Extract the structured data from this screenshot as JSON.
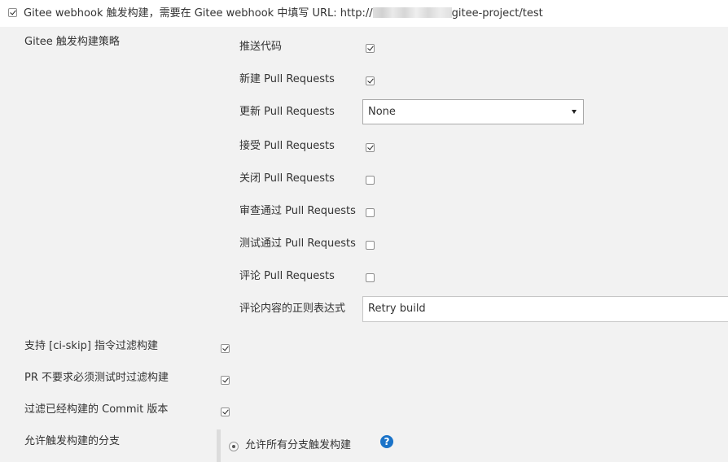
{
  "trigger": {
    "label_prefix": "Gitee webhook 触发构建，需要在 Gitee webhook 中填写 URL: http://",
    "label_suffix": "gitee-project/test",
    "checked": true
  },
  "strategy": {
    "title": "Gitee 触发构建策略",
    "push_code": {
      "label": "推送代码",
      "checked": true
    },
    "new_pr": {
      "label": "新建 Pull Requests",
      "checked": true
    },
    "update_pr": {
      "label": "更新 Pull Requests",
      "value": "None"
    },
    "accept_pr": {
      "label": "接受 Pull Requests",
      "checked": true
    },
    "close_pr": {
      "label": "关闭 Pull Requests",
      "checked": false
    },
    "review_pr": {
      "label": "审查通过 Pull Requests",
      "checked": false
    },
    "test_pr": {
      "label": "测试通过 Pull Requests",
      "checked": false
    },
    "comment_pr": {
      "label": "评论 Pull Requests",
      "checked": false
    },
    "comment_regex": {
      "label": "评论内容的正则表达式",
      "value": "Retry build"
    }
  },
  "options": {
    "ci_skip": {
      "label": "支持 [ci-skip] 指令过滤构建",
      "checked": true
    },
    "pr_no_test": {
      "label": "PR 不要求必须测试时过滤构建",
      "checked": true
    },
    "filter_commit": {
      "label": "过滤已经构建的 Commit 版本",
      "checked": true
    }
  },
  "branches": {
    "title": "允许触发构建的分支",
    "all_option": "允许所有分支触发构建",
    "help_icon": "?"
  }
}
